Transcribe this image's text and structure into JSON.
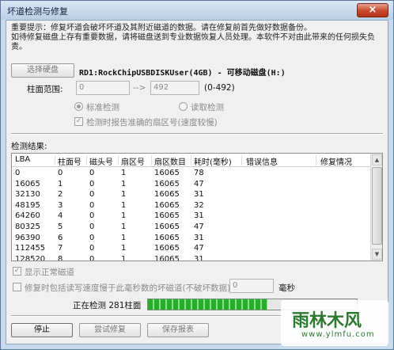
{
  "window": {
    "title": "坏道检测与修复",
    "close_label": "×"
  },
  "notice": {
    "line1": "重要提示：修复坏道会破坏坏道及其附近磁道的数据。请在修复前首先做好数据备份。",
    "line2": "如待修复磁盘上存有重要数据，请将磁盘送到专业数据恢复人员处理。本软件不对由此带来的任何损失负",
    "line3": "责。"
  },
  "disk": {
    "button_label": "选择硬盘",
    "name": "RD1:RockChipUSBDISKUser(4GB) - 可移动磁盘(H:)"
  },
  "cylinder": {
    "label": "柱面范围:",
    "from": "0",
    "to": "492",
    "arrow": "-->",
    "range": "(0-492)"
  },
  "mode": {
    "standard_label": "标准检测",
    "read_label": "读取检测",
    "standard_selected": true
  },
  "report_check": {
    "label": "检测时报告准确的扇区号(速度较慢)",
    "checked": true
  },
  "results": {
    "label": "检测结果:",
    "columns": [
      "LBA",
      "柱面号",
      "磁头号",
      "扇区号",
      "扇区数目",
      "耗时(毫秒)",
      "错误信息",
      "修复情况"
    ],
    "rows": [
      [
        "0",
        "0",
        "0",
        "1",
        "16065",
        "78",
        "",
        ""
      ],
      [
        "16065",
        "1",
        "0",
        "1",
        "16065",
        "47",
        "",
        ""
      ],
      [
        "32130",
        "2",
        "0",
        "1",
        "16065",
        "31",
        "",
        ""
      ],
      [
        "48195",
        "3",
        "0",
        "1",
        "16065",
        "32",
        "",
        ""
      ],
      [
        "64260",
        "4",
        "0",
        "1",
        "16065",
        "31",
        "",
        ""
      ],
      [
        "80325",
        "5",
        "0",
        "1",
        "16065",
        "47",
        "",
        ""
      ],
      [
        "96390",
        "6",
        "0",
        "1",
        "16065",
        "31",
        "",
        ""
      ],
      [
        "112455",
        "7",
        "0",
        "1",
        "16065",
        "47",
        "",
        ""
      ],
      [
        "128520",
        "8",
        "0",
        "1",
        "16065",
        "31",
        "",
        ""
      ]
    ]
  },
  "show_normal": {
    "label": "显示正常磁道",
    "checked": true
  },
  "repair_slow": {
    "label": "修复时包括读写速度慢于此毫秒数的坏磁道(不破坏数据):",
    "ms": "0",
    "unit": "毫秒",
    "checked": false
  },
  "status": {
    "text": "正在检测 281柱面",
    "progress_fraction": 0.571
  },
  "buttons": {
    "stop": "停止",
    "try_repair": "尝试修复",
    "save_report": "保存报表"
  },
  "watermark": {
    "logo": "雨林木风",
    "url": "www.ylmfu.com"
  }
}
